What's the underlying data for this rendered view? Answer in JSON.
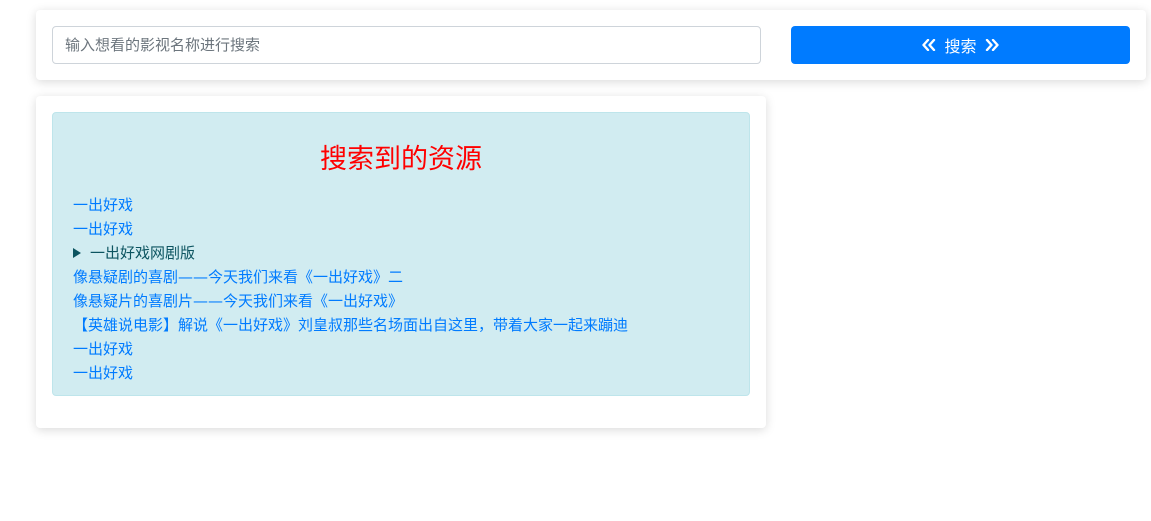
{
  "search": {
    "placeholder": "输入想看的影视名称进行搜索",
    "value": "",
    "button_label": "搜索",
    "left_icon": "double-chevron-left-icon",
    "right_icon": "double-chevron-right-icon"
  },
  "results": {
    "title": "搜索到的资源",
    "title_color": "#ff0000",
    "items": [
      {
        "label": "一出好戏",
        "kind": "link"
      },
      {
        "label": "一出好戏",
        "kind": "link"
      },
      {
        "label": "一出好戏网剧版",
        "kind": "summary"
      },
      {
        "label": "像悬疑剧的喜剧——今天我们来看《一出好戏》二",
        "kind": "link"
      },
      {
        "label": "像悬疑片的喜剧片——今天我们来看《一出好戏》",
        "kind": "link"
      },
      {
        "label": "【英雄说电影】解说《一出好戏》刘皇叔那些名场面出自这里，带着大家一起来蹦迪",
        "kind": "link"
      },
      {
        "label": "一出好戏",
        "kind": "link"
      },
      {
        "label": "一出好戏",
        "kind": "link"
      }
    ]
  },
  "colors": {
    "accent": "#007bff",
    "info_bg": "#d1ecf1",
    "info_border": "#bee5eb",
    "summary_text": "#0c5460"
  }
}
